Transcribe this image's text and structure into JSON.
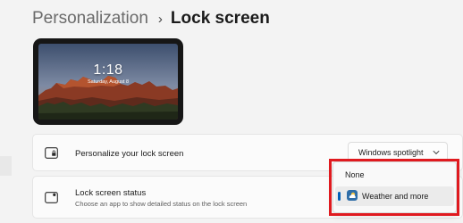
{
  "breadcrumb": {
    "parent": "Personalization",
    "separator": "›",
    "current": "Lock screen"
  },
  "preview": {
    "time": "1:18",
    "date": "Saturday, August 8"
  },
  "personalize_row": {
    "icon": "lock-screen-icon",
    "title": "Personalize your lock screen",
    "dropdown": {
      "selected": "Windows spotlight"
    }
  },
  "status_row": {
    "icon": "status-icon",
    "title": "Lock screen status",
    "subtitle": "Choose an app to show detailed status on the lock screen"
  },
  "status_menu": {
    "options": [
      {
        "label": "None",
        "icon": ""
      },
      {
        "label": "Weather and more",
        "icon": "weather-icon",
        "selected": true
      }
    ]
  },
  "colors": {
    "accent": "#005fb8",
    "highlight_box": "#e01a1f"
  }
}
